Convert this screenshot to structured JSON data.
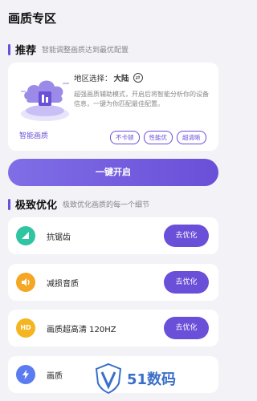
{
  "page": {
    "title": "画质专区"
  },
  "recommend": {
    "title": "推荐",
    "subtitle": "智能调整画质达到最优配置",
    "smart_label": "智能画质",
    "region_label": "地区选择：",
    "region_value": "大陆",
    "description": "超强画质辅助模式，开启后将智能分析你的设备信息，一键为你匹配最佳配置。",
    "tags": [
      "不卡顿",
      "性能优",
      "超清晰"
    ]
  },
  "one_key_button": "一键开启",
  "optimize": {
    "title": "极致优化",
    "subtitle": "极致优化画质的每一个细节",
    "items": [
      {
        "label": "抗锯齿",
        "button": "去优化",
        "icon": "triangle-icon",
        "color": "#2fc4a2"
      },
      {
        "label": "减损音质",
        "button": "去优化",
        "icon": "speaker-icon",
        "color": "#f5a623"
      },
      {
        "label": "画质超高清 120HZ",
        "button": "去优化",
        "icon": "hd-icon",
        "color": "#f5b521"
      },
      {
        "label": "画质",
        "button": "",
        "icon": "bolt-icon",
        "color": "#5b7cf0"
      }
    ]
  },
  "watermark": {
    "text": "51数码"
  },
  "colors": {
    "accent": "#6a4fd8",
    "background": "#f2f2f7"
  }
}
